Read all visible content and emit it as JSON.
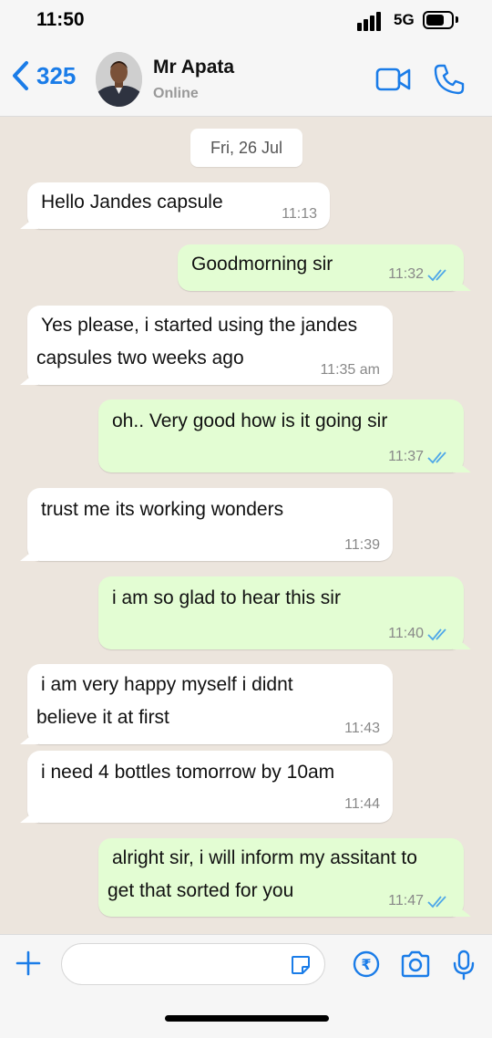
{
  "status_bar": {
    "time": "11:50",
    "network": "5G"
  },
  "header": {
    "back_count": "325",
    "contact_name": "Mr Apata",
    "contact_status": "Online",
    "icons": [
      "video-call-icon",
      "voice-call-icon"
    ]
  },
  "chat": {
    "date_chip": "Fri, 26 Jul",
    "messages": [
      {
        "direction": "in",
        "lines": [
          "Hello Jandes capsule"
        ],
        "time": "11:13"
      },
      {
        "direction": "out",
        "lines": [
          "Goodmorning sir"
        ],
        "time": "11:32",
        "read": true
      },
      {
        "direction": "in",
        "lines": [
          "Yes please, i started using the jandes",
          "capsules two weeks ago"
        ],
        "time": "11:35 am"
      },
      {
        "direction": "out",
        "lines": [
          "oh.. Very good how is it going sir"
        ],
        "time": "11:37",
        "read": true
      },
      {
        "direction": "in",
        "lines": [
          "trust me its working wonders"
        ],
        "time": "11:39"
      },
      {
        "direction": "out",
        "lines": [
          "i am so glad to hear this sir"
        ],
        "time": "11:40",
        "read": true
      },
      {
        "direction": "in",
        "lines": [
          "i am very happy myself i didnt",
          "believe it at first"
        ],
        "time": "11:43"
      },
      {
        "direction": "in",
        "lines": [
          "i need 4 bottles tomorrow by 10am"
        ],
        "time": "11:44"
      },
      {
        "direction": "out",
        "lines": [
          "alright sir, i will inform my assitant to",
          "get that sorted for you"
        ],
        "time": "11:47",
        "read": true
      }
    ]
  },
  "input_bar": {
    "message_value": "",
    "icons": [
      "plus-icon",
      "sticker-icon",
      "payment-icon",
      "camera-icon",
      "microphone-icon"
    ]
  },
  "colors": {
    "accent": "#1a7ce8",
    "outgoing_bubble": "#e3fdd3",
    "incoming_bubble": "#ffffff",
    "read_ticks": "#4fa8e8"
  }
}
